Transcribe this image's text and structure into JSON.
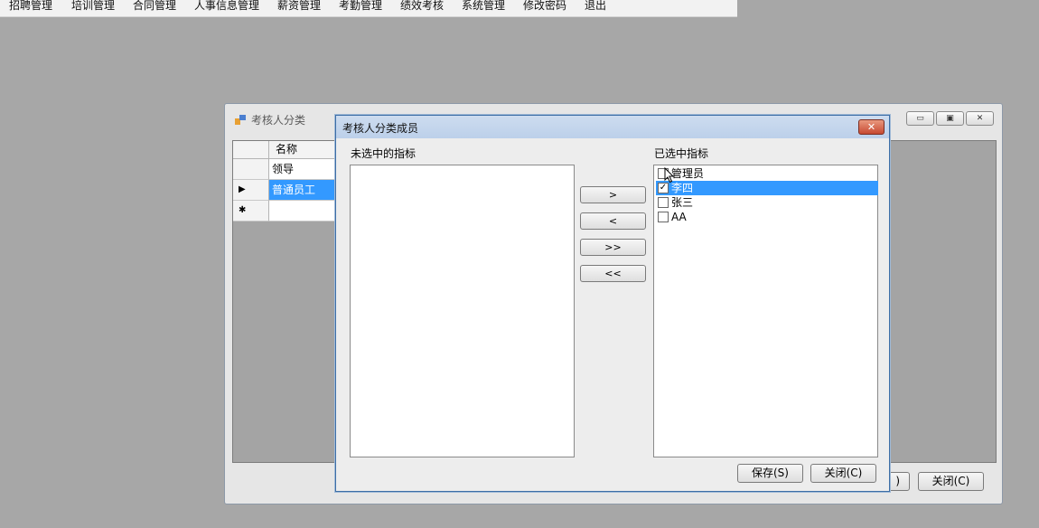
{
  "menu": {
    "items": [
      "招聘管理",
      "培训管理",
      "合同管理",
      "人事信息管理",
      "薪资管理",
      "考勤管理",
      "绩效考核",
      "系统管理",
      "修改密码",
      "退出"
    ]
  },
  "parent_window": {
    "title": "考核人分类",
    "caption_buttons": {
      "minimize": "▭",
      "restore": "▣",
      "close": "✕"
    },
    "grid": {
      "column_header": "名称",
      "rows": [
        {
          "indicator": "",
          "name": "领导",
          "selected": false
        },
        {
          "indicator": "▶",
          "name": "普通员工",
          "selected": true
        },
        {
          "indicator": "✱",
          "name": "",
          "selected": false
        }
      ]
    },
    "buttons": {
      "save_partial": ")",
      "close": "关闭(C)"
    }
  },
  "dialog": {
    "title": "考核人分类成员",
    "close_glyph": "✕",
    "unselected_label": "未选中的指标",
    "selected_label": "已选中指标",
    "unselected_items": [],
    "selected_items": [
      {
        "label": "管理员",
        "checked": false,
        "highlighted": false
      },
      {
        "label": "李四",
        "checked": true,
        "highlighted": true
      },
      {
        "label": "张三",
        "checked": false,
        "highlighted": false
      },
      {
        "label": "AA",
        "checked": false,
        "highlighted": false
      }
    ],
    "move_buttons": {
      "add": ">",
      "remove": "<",
      "add_all": ">>",
      "remove_all": "<<"
    },
    "buttons": {
      "save": "保存(S)",
      "close": "关闭(C)"
    }
  }
}
